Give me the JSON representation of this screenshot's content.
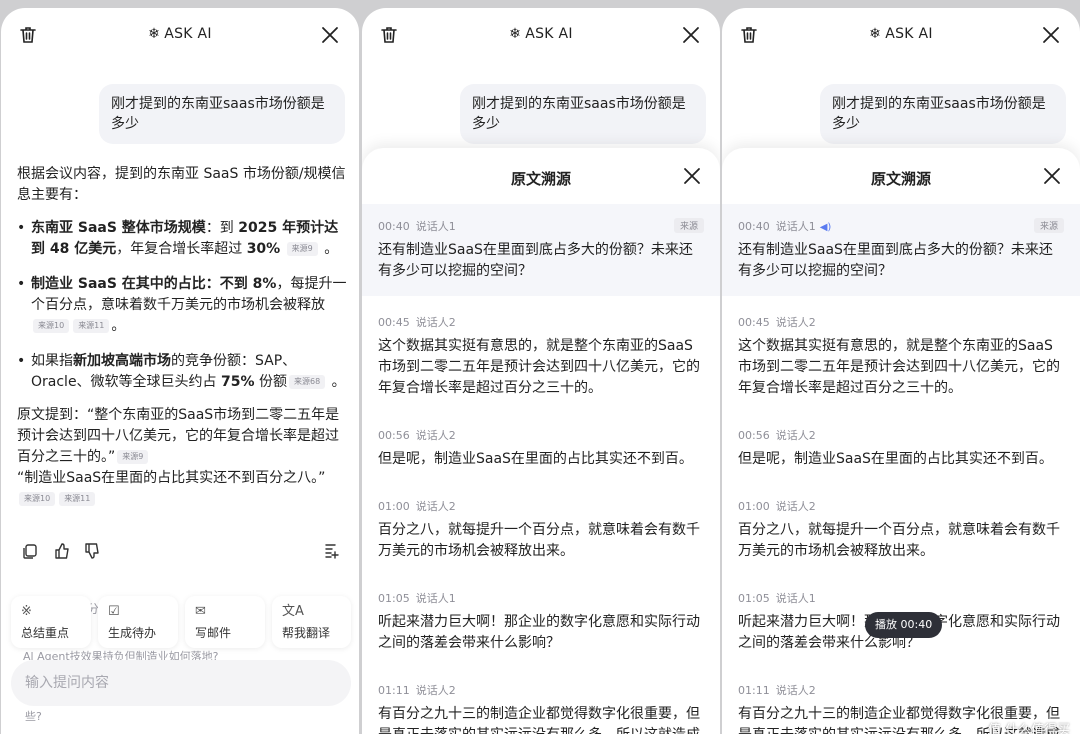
{
  "header": {
    "title": "ASK AI"
  },
  "question": "刚才提到的东南亚saas市场份额是多少",
  "answer": {
    "intro": "根据会议内容，提到的东南亚 SaaS 市场份额/规模信息主要有：",
    "bullets": [
      {
        "bold": "东南亚 SaaS 整体市场规模",
        "text1": "：到 ",
        "bold2": "2025 年预计达到 48 亿美元",
        "text2": "，年复合增长率超过 ",
        "bold3": "30%",
        "src1": "来源9",
        "tail": "。"
      },
      {
        "bold": "制造业 SaaS 在其中的占比：不到 8%",
        "text1": "，每提升一个百分点，意味着数千万美元的市场机会被释放",
        "src1": "来源10",
        "src2": "来源11",
        "tail": "。"
      },
      {
        "text0": "如果指",
        "bold": "新加坡高端市场",
        "text1": "的竞争份额：SAP、Oracle、微软等全球巨头约占 ",
        "bold2": "75%",
        "text2": " 份额",
        "src1": "来源68",
        "tail": "。"
      }
    ],
    "quote1": "原文提到：“整个东南亚的SaaS市场到二零二五年是预计会达到四十八亿美元，它的年复合增长率是超过百分之三十的。”",
    "quote1_src": "来源9",
    "quote2": "“制造业SaaS在里面的占比其实还不到百分之八。”",
    "quote2_src1": "来源10",
    "quote2_src2": "来源11"
  },
  "actions": [
    "copy-icon",
    "thumbs-up-icon",
    "thumbs-down-icon",
    "add-note-icon"
  ],
  "quick_actions": [
    {
      "icon": "※",
      "label": "总结重点"
    },
    {
      "icon": "☑",
      "label": "生成待办"
    },
    {
      "icon": "✉",
      "label": "写邮件"
    },
    {
      "icon": "文A",
      "label": "帮我翻译"
    }
  ],
  "ghost_text": {
    "line1": "分",
    "line2": "Al Agent技效果持负但制造业如何落地?",
    "line3": "些?"
  },
  "input": {
    "placeholder": "输入提问内容"
  },
  "sheet": {
    "title": "原文溯源",
    "source_tag": "来源",
    "entries": [
      {
        "time": "00:40",
        "speaker": "说话人1",
        "text": "还有制造业SaaS在里面到底占多大的份额？未来还有多少可以挖掘的空间？"
      },
      {
        "time": "00:45",
        "speaker": "说话人2",
        "text": "这个数据其实挺有意思的，就是整个东南亚的SaaS市场到二零二五年是预计会达到四十八亿美元，它的年复合增长率是超过百分之三十的。"
      },
      {
        "time": "00:56",
        "speaker": "说话人2",
        "text": "但是呢，制造业SaaS在里面的占比其实还不到百。"
      },
      {
        "time": "01:00",
        "speaker": "说话人2",
        "text": "百分之八，就每提升一个百分点，就意味着会有数千万美元的市场机会被释放出来。"
      },
      {
        "time": "01:05",
        "speaker": "说话人1",
        "text": "听起来潜力巨大啊！那企业的数字化意愿和实际行动之间的落差会带来什么影响？"
      },
      {
        "time": "01:11",
        "speaker": "说话人2",
        "text": "有百分之九十三的制造企业都觉得数字化很重要，但是真正去落实的其实远远没有那么多，所以这就造成"
      }
    ]
  },
  "playing": "播放 00:40",
  "watermark": "值 什么值得买"
}
